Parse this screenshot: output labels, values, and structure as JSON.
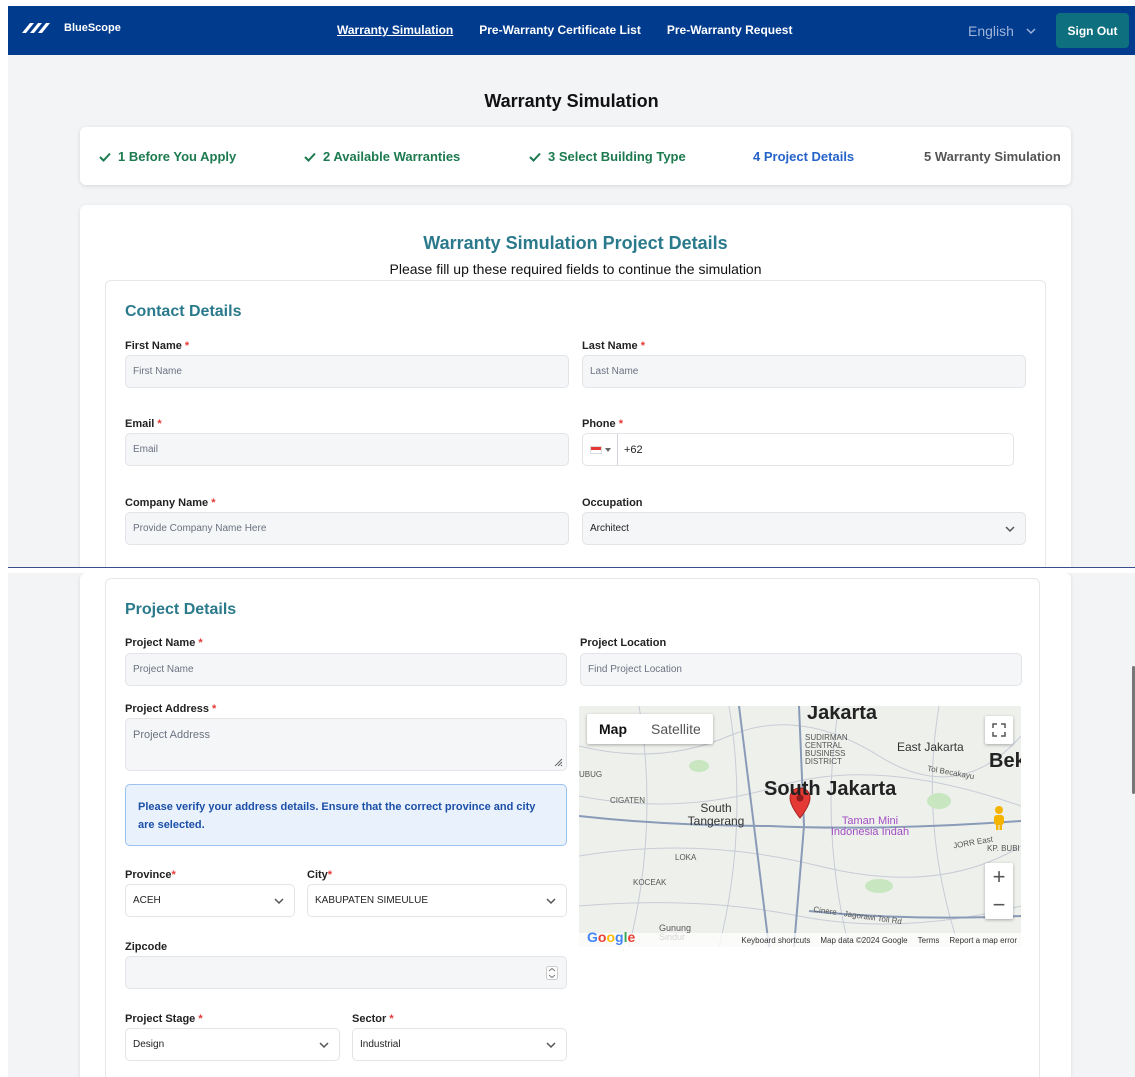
{
  "header": {
    "brand": "BlueScope",
    "nav": [
      {
        "label": "Warranty Simulation"
      },
      {
        "label": "Pre-Warranty Certificate List"
      },
      {
        "label": "Pre-Warranty Request"
      }
    ],
    "language": "English",
    "sign_out": "Sign Out"
  },
  "page_title": "Warranty Simulation",
  "steps": [
    {
      "label": "1 Before You Apply",
      "state": "done"
    },
    {
      "label": "2 Available Warranties",
      "state": "done"
    },
    {
      "label": "3 Select Building Type",
      "state": "done"
    },
    {
      "label": "4 Project Details",
      "state": "current"
    },
    {
      "label": "5 Warranty Simulation",
      "state": "next"
    }
  ],
  "card": {
    "title": "Warranty Simulation Project Details",
    "subtitle": "Please fill up these required fields to continue the simulation"
  },
  "contact": {
    "title": "Contact Details",
    "first_name": {
      "label": "First Name",
      "placeholder": "First Name"
    },
    "last_name": {
      "label": "Last Name",
      "placeholder": "Last Name"
    },
    "email": {
      "label": "Email",
      "placeholder": "Email"
    },
    "phone": {
      "label": "Phone",
      "value": "+62"
    },
    "company": {
      "label": "Company Name",
      "placeholder": "Provide Company Name Here"
    },
    "occupation": {
      "label": "Occupation",
      "value": "Architect"
    }
  },
  "project": {
    "title": "Project Details",
    "name": {
      "label": "Project Name",
      "placeholder": "Project Name"
    },
    "location": {
      "label": "Project Location",
      "placeholder": "Find Project Location"
    },
    "address": {
      "label": "Project Address",
      "placeholder": "Project Address"
    },
    "alert": "Please verify your address details. Ensure that the correct province and city are selected.",
    "province": {
      "label": "Province",
      "value": "ACEH"
    },
    "city": {
      "label": "City",
      "value": "KABUPATEN SIMEULUE"
    },
    "zipcode": {
      "label": "Zipcode",
      "value": ""
    },
    "stage": {
      "label": "Project Stage",
      "value": "Design"
    },
    "sector": {
      "label": "Sector",
      "value": "Industrial"
    }
  },
  "map": {
    "toggle_map": "Map",
    "toggle_satellite": "Satellite",
    "labels": {
      "jakarta": "Jakarta",
      "sudirman": "SUDIRMAN CENTRAL BUSINESS DISTRICT",
      "east_jakarta": "East Jakarta",
      "bek": "Bek",
      "south_jakarta": "South Jakarta",
      "south_tangerang": "South Tangerang",
      "cigaten": "CIGATEN",
      "taman_mini": "Taman Mini Indonesia Indah",
      "loka": "LOKA",
      "koceak": "KOCEAK",
      "gunung_sindur": "Gunung Sindur",
      "kp_bubi": "KP. BUBI",
      "ubug": "UBUG",
      "tol_becakayu": "Tol Becakayu",
      "cinere": "Cinere - Jagorawi Toll Rd",
      "jorr": "JORR East"
    },
    "google": "Google",
    "credits": {
      "shortcuts": "Keyboard shortcuts",
      "data": "Map data ©2024 Google",
      "terms": "Terms",
      "report": "Report a map error"
    }
  },
  "colors": {
    "navbar": "#003b8e",
    "accent_teal": "#2a7a8c",
    "sign_out_bg": "#0e6f7e",
    "step_done": "#1d7a4f",
    "step_current": "#2563c9",
    "required": "#e53935"
  }
}
